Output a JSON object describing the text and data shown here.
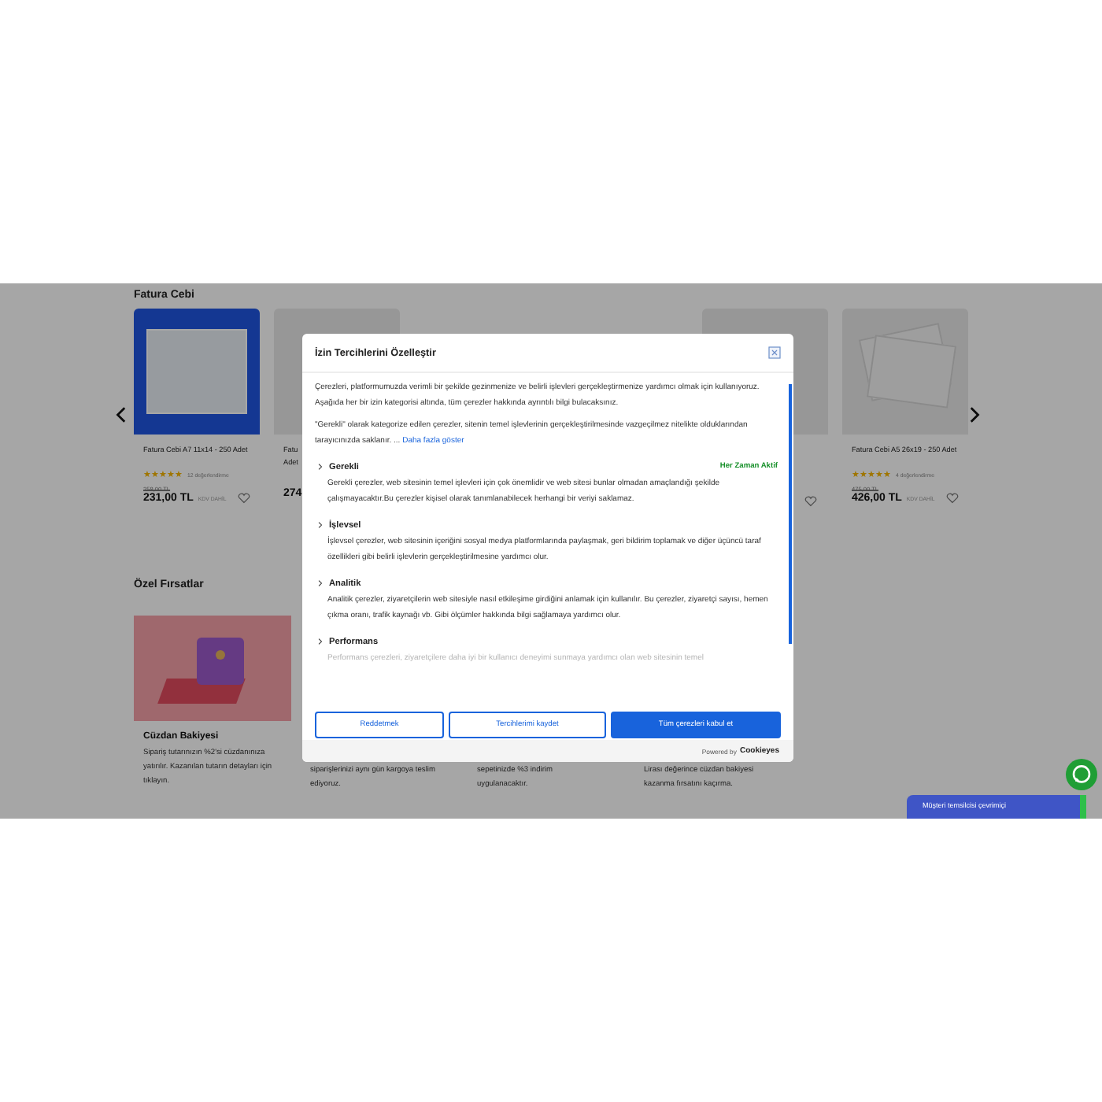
{
  "fatura_section": {
    "title": "Fatura Cebi",
    "products": [
      {
        "kind": "full",
        "title": "Fatura Cebi A7 11x14 - 250 Adet",
        "stars": 5,
        "reviews": "12 değerlendirme",
        "old_price": "258,00 TL",
        "price": "231,00 TL",
        "tax_note": "KDV DAHİL"
      },
      {
        "kind": "clipped",
        "title": "Fatu",
        "title_line2": "Adet",
        "price": "274"
      },
      {
        "kind": "covered"
      },
      {
        "kind": "full",
        "title": "Fatura Cebi A5 26x19 - 250 Adet",
        "stars": 5,
        "reviews": "4 değerlendirme",
        "old_price": "475,00 TL",
        "price": "426,00 TL",
        "tax_note": "KDV DAHİL"
      }
    ]
  },
  "offers_section": {
    "title": "Özel Fırsatlar",
    "cards": [
      {
        "kind": "full",
        "title": "Cüzdan Bakiyesi",
        "text": "Sipariş tutarınızın %2'si cüzdanınıza yatırılır. Kazanılan tutarın detayları için tıklayın."
      },
      {
        "kind": "covered",
        "text": "siparişlerinizi aynı gün kargoya teslim ediyoruz."
      },
      {
        "kind": "covered",
        "text": "sepetinizde %3 indirim uygulanacaktır."
      },
      {
        "kind": "covered",
        "text": "Lirası değerince cüzdan bakiyesi kazanma fırsatını kaçırma."
      }
    ]
  },
  "consent_modal": {
    "title": "İzin Tercihlerini Özelleştir",
    "intro": "Çerezleri, platformumuzda verimli bir şekilde gezinmenize ve belirli işlevleri gerçekleştirmenize yardımcı olmak için kullanıyoruz. Aşağıda her bir izin kategorisi altında, tüm çerezler hakkında ayrıntılı bilgi bulacaksınız.",
    "intro_2": "\"Gerekli\" olarak kategorize edilen çerezler, sitenin temel işlevlerinin gerçekleştirilmesinde vazgeçilmez nitelikte olduklarından tarayıcınızda saklanır. ...",
    "show_more": "Daha fazla göster",
    "categories": [
      {
        "name": "Gerekli",
        "status": "Her Zaman Aktif",
        "description": "Gerekli çerezler, web sitesinin temel işlevleri için çok önemlidir ve web sitesi bunlar olmadan amaçlandığı şekilde çalışmayacaktır.Bu çerezler kişisel olarak tanımlanabilecek herhangi bir veriyi saklamaz."
      },
      {
        "name": "İşlevsel",
        "description": "İşlevsel çerezler, web sitesinin içeriğini sosyal medya platformlarında paylaşmak, geri bildirim toplamak ve diğer üçüncü taraf özellikleri gibi belirli işlevlerin gerçekleştirilmesine yardımcı olur."
      },
      {
        "name": "Analitik",
        "description": "Analitik çerezler, ziyaretçilerin web sitesiyle nasıl etkileşime girdiğini anlamak için kullanılır. Bu çerezler, ziyaretçi sayısı, hemen çıkma oranı, trafik kaynağı vb. Gibi ölçümler hakkında bilgi sağlamaya yardımcı olur."
      },
      {
        "name": "Performans",
        "description": "Performans çerezleri, ziyaretçilere daha iyi bir kullanıcı deneyimi sunmaya yardımcı olan web sitesinin temel"
      }
    ],
    "buttons": [
      {
        "label": "Reddetmek",
        "kind": "outline"
      },
      {
        "label": "Tercihlerimi kaydet",
        "kind": "outline"
      },
      {
        "label": "Tüm çerezleri kabul et",
        "kind": "primary"
      }
    ],
    "powered_by": "Powered by",
    "brand": "Cookieyes"
  },
  "chat_bar": {
    "label": "Müşteri temsilcisi çevrimiçi"
  }
}
